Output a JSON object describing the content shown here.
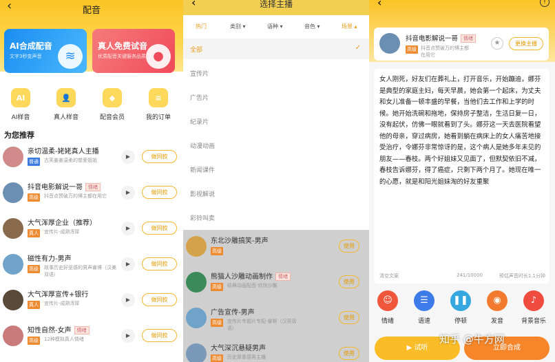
{
  "p1": {
    "title": "配音",
    "banners": [
      {
        "title": "AI合成配音",
        "sub": "文字3秒变声音",
        "icon": "soundwave-icon"
      },
      {
        "title": "真人免费试音",
        "sub": "优质配音关键服务品质",
        "icon": "record-icon"
      }
    ],
    "quick": [
      {
        "label": "AI样音",
        "icon": "AI"
      },
      {
        "label": "真人样音",
        "icon": "👤"
      },
      {
        "label": "配音会员",
        "icon": "◆"
      },
      {
        "label": "我的订单",
        "icon": "≡"
      }
    ],
    "section": "为您推荐",
    "action": "做同款",
    "items": [
      {
        "name": "亲切温柔-姥姥真人主播",
        "tag": "",
        "badge": "普通",
        "desc": "古芙姜姜温柔的慈爱姐姐",
        "color": "#d08a8a"
      },
      {
        "name": "抖音电影解说一哥",
        "tag": "情绪",
        "badge": "高级",
        "desc": "抖音点赞破万的博主都在用它",
        "color": "#6b8fb3"
      },
      {
        "name": "大气浑厚企业（推荐）",
        "tag": "",
        "badge": "真人",
        "desc": "宣传片-成熟浑厚",
        "color": "#8a6a4d"
      },
      {
        "name": "磁性有力-男声",
        "tag": "",
        "badge": "高级",
        "desc": "故事历史好坚感的男声睿博（汉美双语）",
        "color": "#6fa3c9"
      },
      {
        "name": "大气浑厚宣传+银行",
        "tag": "",
        "badge": "真人",
        "desc": "宣传片-成熟浑厚",
        "color": "#5a4a3a"
      },
      {
        "name": "知性自然-女声",
        "tag": "情绪",
        "badge": "高级",
        "desc": "12种模拟真人情绪",
        "color": "#c97a7a"
      }
    ]
  },
  "p2": {
    "title": "选择主播",
    "tabs": [
      {
        "label": "热门"
      },
      {
        "label": "类别 ▾"
      },
      {
        "label": "语种 ▾"
      },
      {
        "label": "音色 ▾"
      },
      {
        "label": "场景 ▴"
      }
    ],
    "options": [
      "全部",
      "宣传片",
      "广告片",
      "纪录片",
      "动漫动画",
      "新闻课件",
      "影视解说",
      "彩铃叫卖"
    ],
    "check": "✓",
    "use": "使用",
    "items": [
      {
        "name": "东北沙雕搞笑-男声",
        "tag": "",
        "badge": "高级",
        "desc": "",
        "color": "#d4a24a"
      },
      {
        "name": "熊猫人沙雕动画制作",
        "tag": "情绪",
        "badge": "高级",
        "desc": "经典动画配音-欢快沙雕",
        "color": "#3a8a5a"
      },
      {
        "name": "广告宣传-男声",
        "tag": "",
        "badge": "高级",
        "desc": "宣传片专题片专配-睿晰（汉英双语）",
        "color": "#6fa3c9"
      },
      {
        "name": "大气深沉悬疑男声",
        "tag": "",
        "badge": "高级",
        "desc": "历史厚重感男主播",
        "color": "#7a98b8"
      }
    ]
  },
  "p3": {
    "card": {
      "name": "抖音电影解说一哥",
      "tag": "情绪",
      "badge": "高级",
      "desc": "抖音点赞破万的博主都在用它",
      "change": "更换主播"
    },
    "text": "女人刚死，好友们在葬礼上，打开音乐，开始蹦迪，娜芬是典型的家庭主妇，每天早晨，她会第一个起床，为丈夫和女儿准备一顿丰盛的早餐，当他们去工作和上学的时候。她开始洗碗和拖地，保持房子整洁，生活日复一日，没有起伏，仿佛一眼就看到了头。娜芬这一天去医院看望他的母亲，穿过病房，她看到躺在病床上的女人痛苦地接受治疗，令娜芬非常惊讶的是，这个病人是她多年未见的朋友——春枝。两个好姐妹又见面了，但默契依旧不减，春枝告诉娜芬，得了癌症，只剩下两个月了。她现在唯一的心愿，就是和阳光姐妹淘的好友重聚",
    "clear": "清空文案",
    "count": "241/10000",
    "est": "预估声音时长1.1分钟",
    "tools": [
      {
        "label": "情绪",
        "icon": "☺",
        "color": "#f0563a"
      },
      {
        "label": "语速",
        "icon": "☰",
        "color": "#3d7be8"
      },
      {
        "label": "停顿",
        "icon": "❚❚",
        "color": "#36a8e0"
      },
      {
        "label": "发音",
        "icon": "◉",
        "color": "#f27a2e"
      },
      {
        "label": "背景音乐",
        "icon": "♪",
        "color": "#ef4b3f"
      }
    ],
    "trial": "试听",
    "synth": "立即合成",
    "watermark": "知乎 @牛方网"
  }
}
